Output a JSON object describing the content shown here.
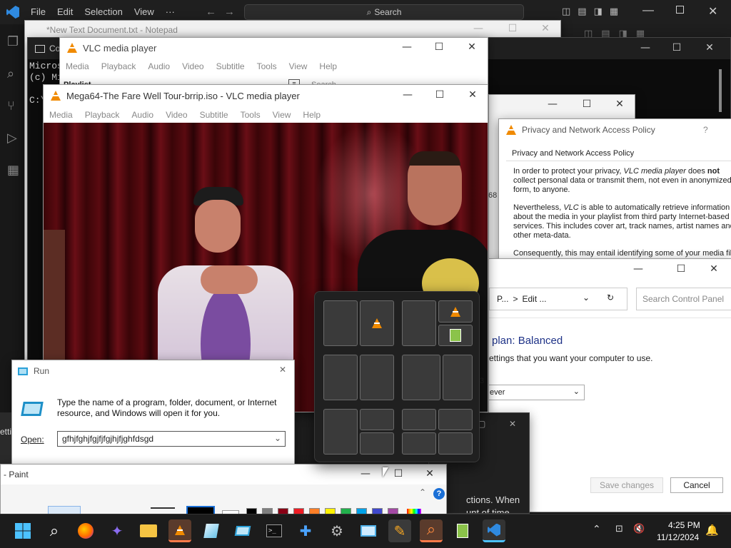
{
  "vscode": {
    "menu": [
      "File",
      "Edit",
      "Selection",
      "View",
      "···"
    ],
    "search_label": "Search",
    "nav_back": "←",
    "nav_forward": "→"
  },
  "notepad": {
    "title": "*New Text Document.txt - Notepad"
  },
  "cmd": {
    "title": "Co",
    "lines": [
      "Micros",
      "(c) Mi",
      "",
      "C:\\"
    ]
  },
  "vlc_back": {
    "title": "VLC media player",
    "menu": [
      "Media",
      "Playback",
      "Audio",
      "Video",
      "Subtitle",
      "Tools",
      "View",
      "Help"
    ],
    "playlist_label": "Playlist",
    "search_placeholder": "Search"
  },
  "vlc_main": {
    "title": "Mega64-The Fare Well Tour-brrip.iso - VLC media player",
    "menu": [
      "Media",
      "Playback",
      "Audio",
      "Video",
      "Subtitle",
      "Tools",
      "View",
      "Help"
    ]
  },
  "privacy": {
    "title": "Privacy and Network Access Policy",
    "help": "?",
    "heading": "Privacy and Network Access Policy",
    "p1_a": "In order to protect your privacy, ",
    "p1_app": "VLC media player",
    "p1_b": " does ",
    "p1_not": "not",
    "p1_c": " collect personal data or transmit them, not even in anonymized form, to anyone.",
    "p2_a": "Nevertheless, ",
    "p2_app": "VLC",
    "p2_b": " is able to automatically retrieve information about the media in your playlist from third party Internet-based services. This includes cover art, track names, artist names and other meta-data.",
    "p3": "Consequently, this may entail identifying some of your media fil"
  },
  "behind_number": "68",
  "control_panel": {
    "breadcrumb_p": "P...",
    "breadcrumb_sep": ">",
    "breadcrumb_edit": "Edit ...",
    "search_placeholder": "Search Control Panel",
    "plan_title": "plan: Balanced",
    "plan_desc": "ettings that you want your computer to use.",
    "select_value": "ever",
    "save_label": "Save changes",
    "cancel_label": "Cancel"
  },
  "dark_dialog": {
    "line1": "ctions. When",
    "line2": "unt of time"
  },
  "left_edge_text": "etti",
  "small_number": "3",
  "run": {
    "title": "Run",
    "description": "Type the name of a program, folder, document, or Internet resource, and Windows will open it for you.",
    "open_label": "Open:",
    "open_value": "gfhjfghjfgjfjfgjhjfjghfdsgd"
  },
  "paint": {
    "title": "- Paint",
    "help": "?"
  },
  "palette": [
    "#000000",
    "#7f7f7f",
    "#880015",
    "#ed1c24",
    "#ff7f27",
    "#fff200",
    "#22b14c",
    "#00a2e8",
    "#3f48cc",
    "#a349a4"
  ],
  "taskbar": {
    "time": "4:25 PM",
    "date": "11/12/2024",
    "icons": [
      "start-icon",
      "search-icon",
      "firefox-icon",
      "bird-app-icon",
      "file-explorer-icon",
      "vlc-icon",
      "notepad-app-icon",
      "run-app-icon",
      "terminal-icon",
      "puzzle-app-icon",
      "settings-icon",
      "remote-desktop-icon",
      "paint-icon",
      "magnifier-icon",
      "notepad-plus-icon",
      "vscode-icon"
    ]
  }
}
